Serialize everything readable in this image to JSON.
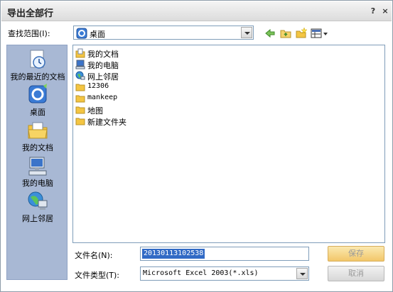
{
  "dialog": {
    "title": "导出全部行",
    "help_glyph": "?",
    "close_glyph": "×"
  },
  "lookin": {
    "label": "查找范围(I):",
    "value": "桌面"
  },
  "places": [
    {
      "label": "我的最近的文档",
      "icon": "recent-documents-icon"
    },
    {
      "label": "桌面",
      "icon": "desktop-icon"
    },
    {
      "label": "我的文档",
      "icon": "my-documents-icon"
    },
    {
      "label": "我的电脑",
      "icon": "my-computer-icon"
    },
    {
      "label": "网上邻居",
      "icon": "network-places-icon"
    }
  ],
  "files": [
    {
      "label": "我的文档",
      "icon": "my-documents-icon"
    },
    {
      "label": "我的电脑",
      "icon": "my-computer-icon"
    },
    {
      "label": "网上邻居",
      "icon": "network-places-icon"
    },
    {
      "label": "12306",
      "icon": "folder-icon"
    },
    {
      "label": "mankeep",
      "icon": "folder-icon"
    },
    {
      "label": "地图",
      "icon": "folder-icon"
    },
    {
      "label": "新建文件夹",
      "icon": "folder-icon"
    }
  ],
  "filename": {
    "label": "文件名(N):",
    "value": "20130113102538"
  },
  "filetype": {
    "label": "文件类型(T):",
    "value": "Microsoft Excel 2003(*.xls)"
  },
  "buttons": {
    "save": "保存",
    "cancel": "取消"
  },
  "colors": {
    "selection": "#316ac5",
    "places_bg": "#a8b8d4",
    "folder": "#f4c542"
  }
}
